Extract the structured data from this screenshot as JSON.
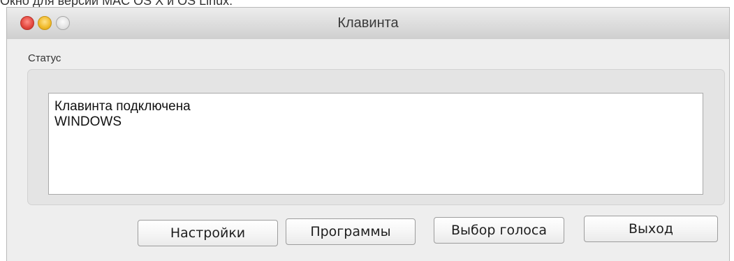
{
  "document": {
    "caption": "Окно для версии MAC OS X и OS Linux:"
  },
  "window": {
    "title": "Клавинта",
    "traffic_lights": {
      "close_color": "#e2463d",
      "minimize_color": "#f0b928",
      "zoom_color": "#e3e3e3"
    }
  },
  "status_group": {
    "label": "Статус",
    "lines": [
      "Клавинта подключена",
      "WINDOWS"
    ]
  },
  "buttons": {
    "settings": "Настройки",
    "programs": "Программы",
    "voice_select": "Выбор голоса",
    "exit": "Выход"
  }
}
